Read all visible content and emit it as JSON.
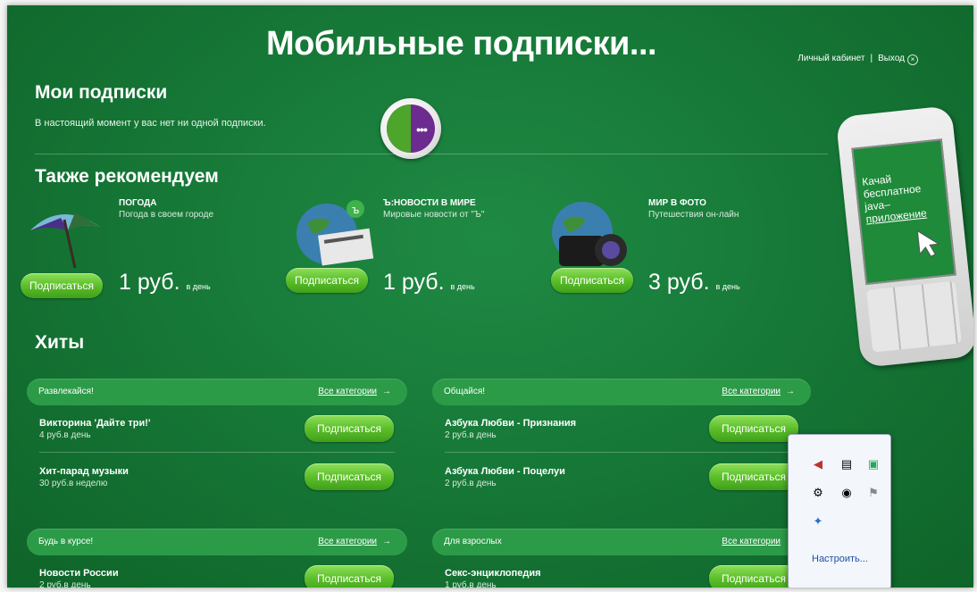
{
  "header": {
    "title": "Мобильные подписки...",
    "account_link": "Личный кабинет",
    "separator": "|",
    "logout_link": "Выход"
  },
  "my_subs": {
    "heading": "Мои подписки",
    "empty_text": "В настоящий момент у вас нет ни одной подписки."
  },
  "recommend": {
    "heading": "Также рекомендуем",
    "items": [
      {
        "title": "ПОГОДА",
        "subtitle": "Погода в своем городе",
        "button": "Подписаться",
        "price": "1 руб.",
        "period": "в день",
        "icon": "umbrella-icon"
      },
      {
        "title": "Ъ:НОВОСТИ В МИРЕ",
        "subtitle": "Мировые новости от \"Ъ\"",
        "button": "Подписаться",
        "price": "1 руб.",
        "period": "в день",
        "icon": "globe-newspaper-icon"
      },
      {
        "title": "МИР В ФОТО",
        "subtitle": "Путешествия он-лайн",
        "button": "Подписаться",
        "price": "3 руб.",
        "period": "в день",
        "icon": "globe-camera-icon"
      }
    ]
  },
  "hits": {
    "heading": "Хиты",
    "categories": [
      {
        "name": "Развлекайся!",
        "link": "Все категории",
        "items": [
          {
            "title": "Викторина 'Дайте три!'",
            "price": "4 руб.в день",
            "button": "Подписаться"
          },
          {
            "title": "Хит-парад музыки",
            "price": "30 руб.в неделю",
            "button": "Подписаться"
          }
        ]
      },
      {
        "name": "Общайся!",
        "link": "Все категории",
        "items": [
          {
            "title": "Азбука Любви - Признания",
            "price": "2 руб.в день",
            "button": "Подписаться"
          },
          {
            "title": "Азбука Любви - Поцелуи",
            "price": "2 руб.в день",
            "button": "Подписаться"
          }
        ]
      },
      {
        "name": "Будь в курсе!",
        "link": "Все категории",
        "items": [
          {
            "title": "Новости России",
            "price": "2 руб.в день",
            "button": "Подписаться"
          }
        ]
      },
      {
        "name": "Для взрослых",
        "link": "Все категории",
        "items": [
          {
            "title": "Секс-энциклопедия",
            "price": "1 руб.в день",
            "button": "Подписаться"
          }
        ]
      }
    ]
  },
  "phone_promo": {
    "lines": [
      "Качай",
      "бесплатное",
      "java–",
      "приложение"
    ]
  },
  "tray": {
    "icons": [
      "speaker-icon",
      "film-icon",
      "network-icon",
      "gear-icon",
      "cd-icon",
      "flag-icon",
      "bluetooth-icon"
    ],
    "customize_link": "Настроить..."
  },
  "colors": {
    "background": "#157535",
    "button": "#5cbf2a",
    "category_bar": "#2c9b48"
  }
}
